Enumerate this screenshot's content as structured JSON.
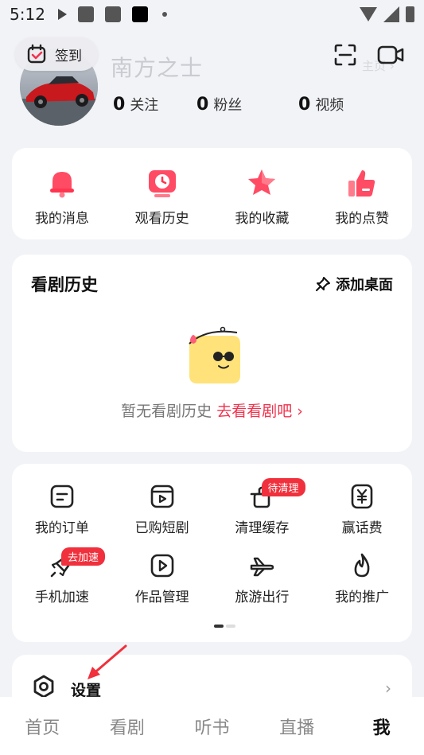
{
  "status_bar": {
    "time": "5:12"
  },
  "header": {
    "checkin_label": "签到",
    "username": "南方之士",
    "homepage_label": "主页 ›",
    "stats": [
      {
        "num": "0",
        "label": "关注"
      },
      {
        "num": "0",
        "label": "粉丝"
      },
      {
        "num": "0",
        "label": "视频"
      }
    ]
  },
  "quick_actions": [
    {
      "label": "我的消息",
      "icon": "bell-icon"
    },
    {
      "label": "观看历史",
      "icon": "history-clock-icon"
    },
    {
      "label": "我的收藏",
      "icon": "star-icon"
    },
    {
      "label": "我的点赞",
      "icon": "thumbs-up-icon"
    }
  ],
  "history": {
    "title": "看剧历史",
    "add_desktop_label": "添加桌面",
    "empty_text": "暂无看剧历史",
    "cta_text": "去看看剧吧 ›"
  },
  "tools": [
    {
      "label": "我的订单",
      "icon": "order-icon",
      "badge": ""
    },
    {
      "label": "已购短剧",
      "icon": "purchased-drama-icon",
      "badge": ""
    },
    {
      "label": "清理缓存",
      "icon": "broom-icon",
      "badge": "待清理"
    },
    {
      "label": "赢话费",
      "icon": "yen-icon",
      "badge": ""
    },
    {
      "label": "手机加速",
      "icon": "rocket-icon",
      "badge": "去加速"
    },
    {
      "label": "作品管理",
      "icon": "works-icon",
      "badge": ""
    },
    {
      "label": "旅游出行",
      "icon": "airplane-icon",
      "badge": ""
    },
    {
      "label": "我的推广",
      "icon": "flame-icon",
      "badge": ""
    }
  ],
  "settings": {
    "label": "设置"
  },
  "bottom_nav": [
    {
      "label": "首页",
      "active": false
    },
    {
      "label": "看剧",
      "active": false
    },
    {
      "label": "听书",
      "active": false
    },
    {
      "label": "直播",
      "active": false
    },
    {
      "label": "我",
      "active": true
    }
  ],
  "colors": {
    "accent": "#f0334d",
    "badge": "#f0303c",
    "background": "#f2f3f7"
  }
}
